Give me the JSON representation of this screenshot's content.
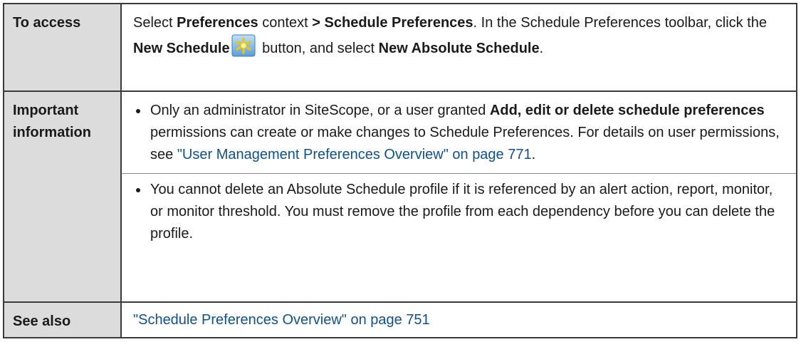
{
  "rows": [
    {
      "label": "To access",
      "content": {
        "t1": "Select ",
        "b1": "Preferences",
        "t2": " context ",
        "b2": "> Schedule Preferences",
        "t3": ". In the Schedule Preferences toolbar, click the ",
        "b3": "New Schedule",
        "icon": "new-schedule-icon",
        "t4": " button, and select ",
        "b4": "New Absolute Schedule",
        "t5": "."
      }
    },
    {
      "label": "Important information",
      "bullets": [
        {
          "t1": "Only an administrator in SiteScope, or a user granted ",
          "b1": "Add, edit or delete schedule preferences",
          "t2": " permissions can create or make changes to Schedule Preferences. For details on user permissions, see ",
          "link": "\"User Management Preferences Overview\" on page 771",
          "t3": "."
        },
        {
          "text": "You cannot delete an Absolute Schedule profile if it is referenced by an alert action, report, monitor, or monitor threshold. You must remove the profile from each dependency before you can delete the profile."
        }
      ]
    },
    {
      "label": "See also",
      "link": "\"Schedule Preferences Overview\" on page 751"
    }
  ],
  "colors": {
    "label_bg": "#dcdcdc",
    "link": "#10508f",
    "icon_yellow": "#f4c400",
    "icon_blue": "#5a9ed6"
  }
}
